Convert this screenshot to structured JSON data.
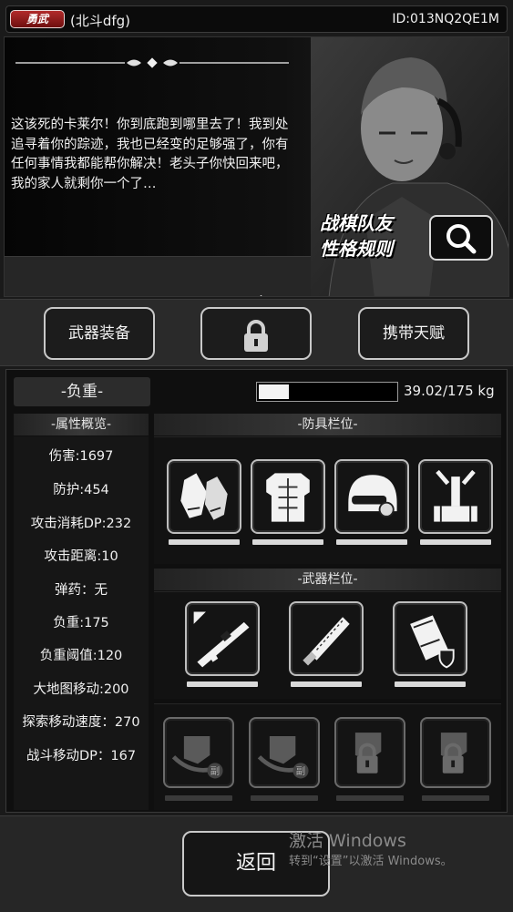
{
  "header": {
    "rank_badge": "勇武",
    "player_name": "(北斗dfg)",
    "player_id": "ID:013NQ2QE1M"
  },
  "story": {
    "dialogue": "这该死的卡莱尔！你到底跑到哪里去了！我到处追寻着你的踪迹，我也已经变的足够强了，你有任何事情我都能帮你解决！老头子你快回来吧，我的家人就剩你一个了…",
    "rule_label_line1": "战棋队友",
    "rule_label_line2": "性格规则",
    "search_icon": "magnifier-icon"
  },
  "tabs": [
    {
      "label": "武器装备"
    },
    {
      "label": "",
      "locked": true,
      "icon": "lock-icon"
    },
    {
      "label": "携带天赋"
    }
  ],
  "load": {
    "label": "-负重-",
    "current": 39.02,
    "max": 175,
    "text": "39.02/175 kg"
  },
  "stats": {
    "header": "-属性概览-",
    "items": [
      "伤害:1697",
      "防护:454",
      "攻击消耗DP:232",
      "攻击距离:10",
      "弹药：无",
      "负重:175",
      "负重阈值:120",
      "大地图移动:200",
      "探索移动速度：270",
      "战斗移动DP：167"
    ]
  },
  "armor": {
    "header": "-防具栏位-",
    "slots": [
      {
        "icon": "gloves-icon"
      },
      {
        "icon": "body-armor-icon"
      },
      {
        "icon": "helmet-icon"
      },
      {
        "icon": "backpack-frame-icon"
      }
    ]
  },
  "weapons": {
    "header": "-武器栏位-",
    "slots": [
      {
        "icon": "rifle-icon"
      },
      {
        "icon": "blade-icon"
      },
      {
        "icon": "shield-icon"
      }
    ]
  },
  "sub_slots": [
    {
      "icon": "grab-hand-icon",
      "badge": "副"
    },
    {
      "icon": "grab-hand-icon",
      "badge": "副"
    },
    {
      "icon": "grab-hand-icon",
      "locked": true
    },
    {
      "icon": "grab-hand-icon",
      "locked": true
    }
  ],
  "footer": {
    "back_label": "返回",
    "watermark_title": "激活 Windows",
    "watermark_sub": "转到“设置”以激活 Windows。"
  }
}
